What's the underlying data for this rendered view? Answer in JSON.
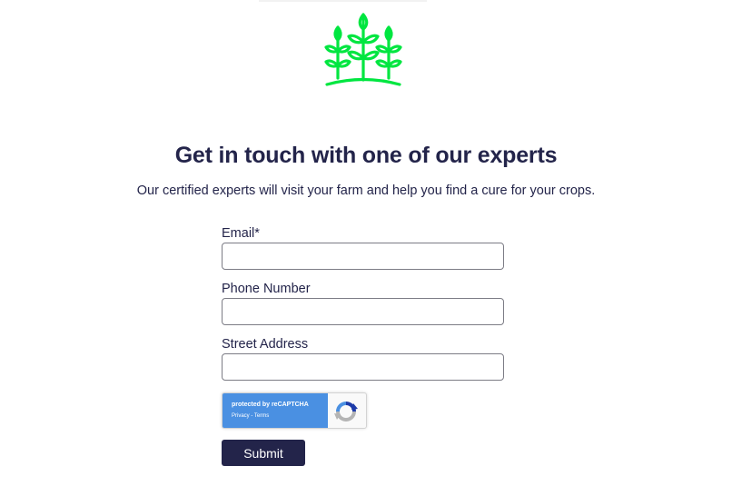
{
  "logo": {
    "icon": "crops-sprout-icon",
    "color": "#00e640"
  },
  "header": {
    "title": "Get in touch with one of our experts",
    "subtitle": "Our certified experts will visit your farm and help you find a cure for your crops."
  },
  "form": {
    "email_label": "Email*",
    "email_value": "",
    "phone_label": "Phone Number",
    "phone_value": "",
    "address_label": "Street Address",
    "address_value": "",
    "submit_label": "Submit"
  },
  "recaptcha": {
    "title": "protected by reCAPTCHA",
    "links": "Privacy - Terms",
    "icon": "recaptcha-icon"
  },
  "colors": {
    "primary": "#23244a",
    "recaptcha_blue": "#4a90e2",
    "logo_green": "#00e640"
  }
}
